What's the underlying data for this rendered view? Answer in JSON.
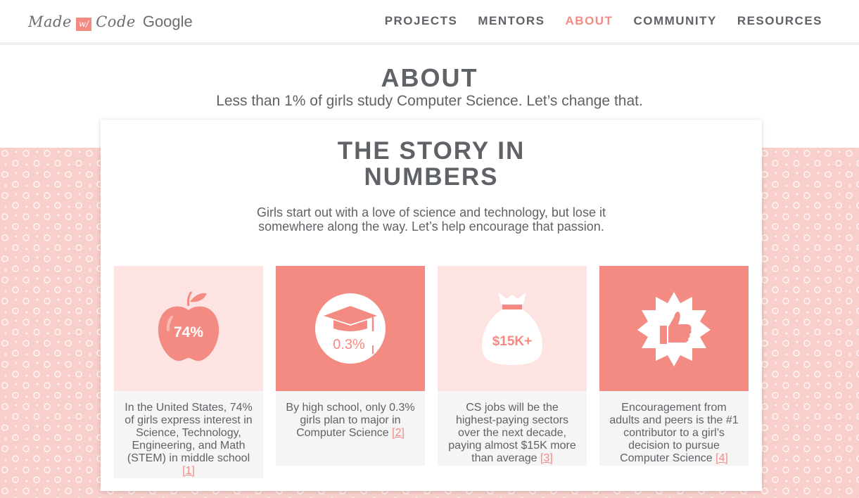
{
  "header": {
    "logo": {
      "made": "Made",
      "with": "w/",
      "code": "Code",
      "google": "Google"
    },
    "nav": [
      {
        "label": "PROJECTS",
        "active": false
      },
      {
        "label": "MENTORS",
        "active": false
      },
      {
        "label": "ABOUT",
        "active": true
      },
      {
        "label": "COMMUNITY",
        "active": false
      },
      {
        "label": "RESOURCES",
        "active": false
      }
    ]
  },
  "hero": {
    "title": "ABOUT",
    "subtitle": "Less than 1% of girls study Computer Science. Let’s change that."
  },
  "story": {
    "title_line1": "THE STORY IN",
    "title_line2": "NUMBERS",
    "description": "Girls start out with a love of science and technology, but lose it somewhere along the way. Let’s help encourage that passion.",
    "tiles": [
      {
        "icon": "apple-icon",
        "stat": "74%",
        "text": "In the United States, 74% of girls express interest in Science, Technology, Engineering, and Math (STEM) in middle school",
        "ref": "[1]"
      },
      {
        "icon": "graduation-cap-icon",
        "stat": "0.3%",
        "text": "By high school, only 0.3% girls plan to major in Computer Science",
        "ref": "[2]"
      },
      {
        "icon": "money-bag-icon",
        "stat": "$15K+",
        "text": "CS jobs will be the highest-paying sectors over the next decade, paying almost $15K more than average",
        "ref": "[3]"
      },
      {
        "icon": "thumbs-up-badge-icon",
        "stat": "",
        "text": "Encouragement from adults and peers is the #1 contributor to a girl’s decision to pursue Computer Science",
        "ref": "[4]"
      }
    ]
  },
  "colors": {
    "accent": "#f48b83",
    "pink_band": "#f9cfcb",
    "light_tile": "#fde4e2",
    "text": "#5f6266"
  }
}
